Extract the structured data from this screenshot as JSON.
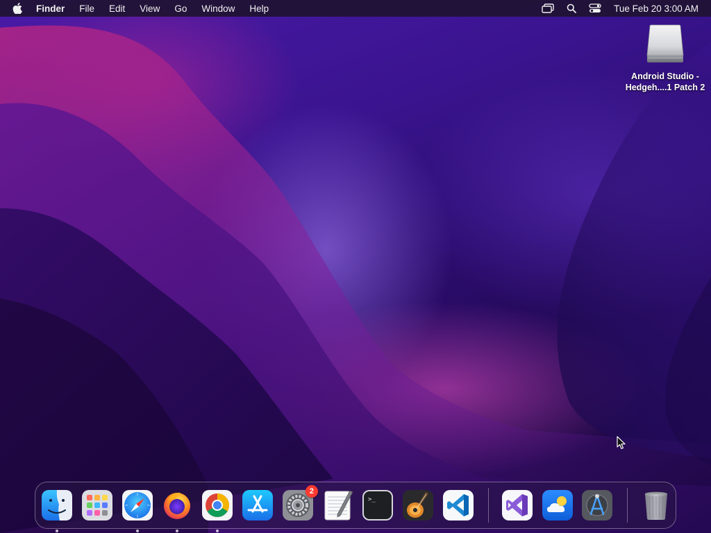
{
  "menubar": {
    "app_name": "Finder",
    "menus": [
      "File",
      "Edit",
      "View",
      "Go",
      "Window",
      "Help"
    ],
    "clock": "Tue Feb 20  3:00 AM",
    "status_icons": [
      "screen-mirroring-icon",
      "spotlight-search-icon",
      "control-center-icon"
    ]
  },
  "desktop": {
    "items": [
      {
        "label": "Android Studio - Hedgeh....1 Patch 2",
        "icon": "external-disk-icon"
      }
    ]
  },
  "dock": {
    "apps": [
      {
        "name": "Finder",
        "icon": "finder-icon",
        "running": true
      },
      {
        "name": "Launchpad",
        "icon": "launchpad-icon",
        "running": false
      },
      {
        "name": "Safari",
        "icon": "safari-icon",
        "running": true
      },
      {
        "name": "Firefox",
        "icon": "firefox-icon",
        "running": true
      },
      {
        "name": "Google Chrome",
        "icon": "chrome-icon",
        "running": true
      },
      {
        "name": "App Store",
        "icon": "app-store-icon",
        "running": false
      },
      {
        "name": "System Settings",
        "icon": "system-settings-icon",
        "running": false,
        "badge": "2"
      },
      {
        "name": "TextEdit",
        "icon": "textedit-icon",
        "running": false
      },
      {
        "name": "Terminal",
        "icon": "terminal-icon",
        "running": false
      },
      {
        "name": "GarageBand",
        "icon": "garageband-icon",
        "running": false
      },
      {
        "name": "Visual Studio Code",
        "icon": "vscode-icon",
        "running": false
      },
      {
        "name": "Visual Studio",
        "icon": "visual-studio-icon",
        "running": false
      },
      {
        "name": "Weather",
        "icon": "weather-icon",
        "running": false
      },
      {
        "name": "Instruments",
        "icon": "instruments-icon",
        "running": false
      },
      {
        "name": "Trash",
        "icon": "trash-icon",
        "running": false
      }
    ]
  }
}
